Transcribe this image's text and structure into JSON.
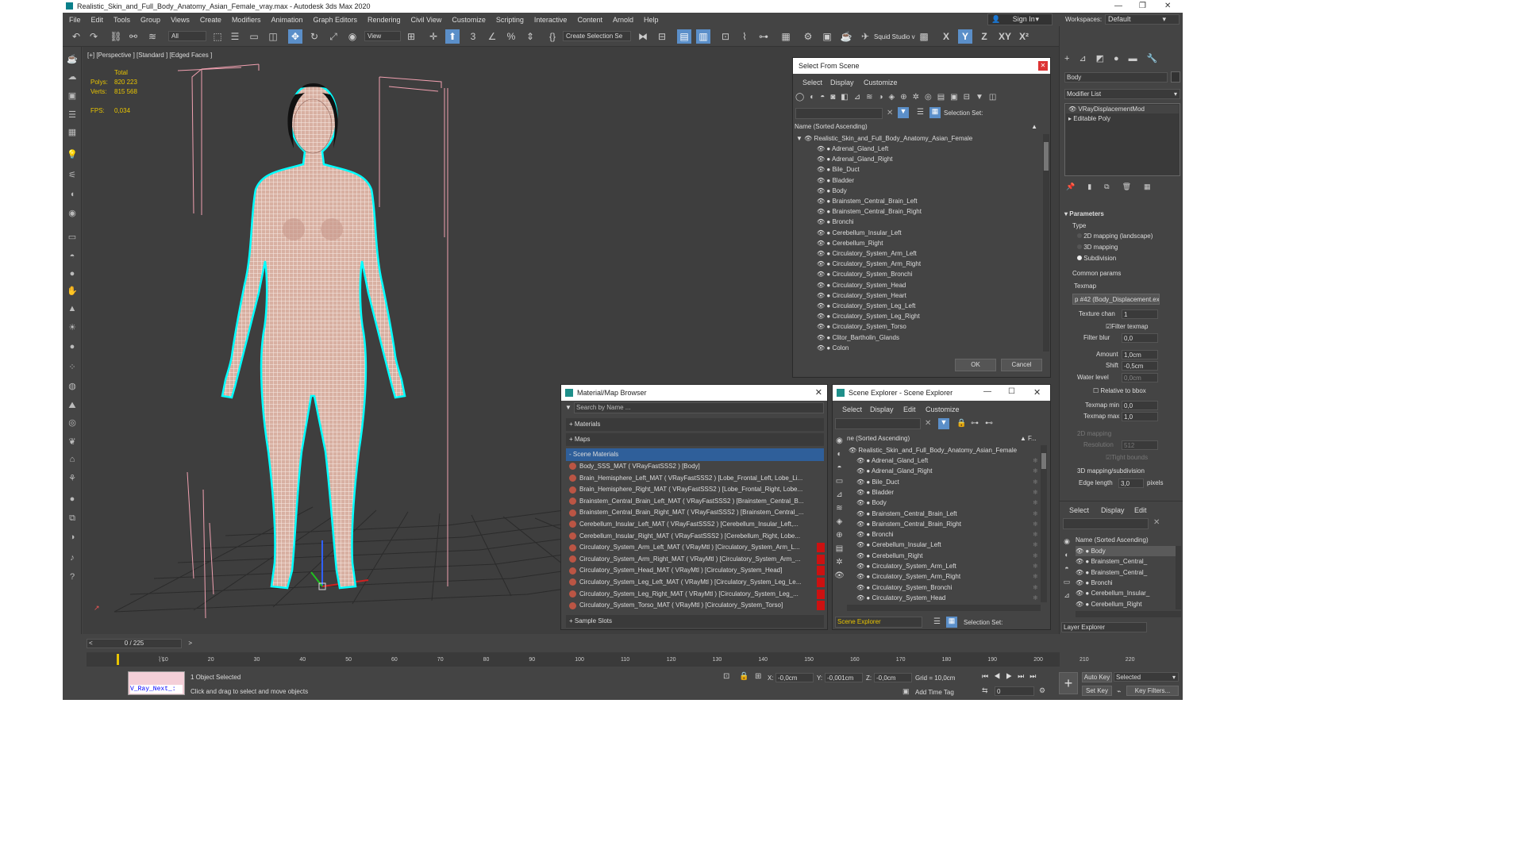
{
  "app": {
    "title": "Realistic_Skin_and_Full_Body_Anatomy_Asian_Female_vray.max - Autodesk 3ds Max 2020"
  },
  "menu": [
    "File",
    "Edit",
    "Tools",
    "Group",
    "Views",
    "Create",
    "Modifiers",
    "Animation",
    "Graph Editors",
    "Rendering",
    "Civil View",
    "Customize",
    "Scripting",
    "Interactive",
    "Content",
    "Arnold",
    "Help"
  ],
  "account": {
    "sign_in": "Sign In",
    "workspaces_label": "Workspaces:",
    "workspace": "Default"
  },
  "toolbar": {
    "filter": "All",
    "view": "View",
    "selection_set": "Create Selection Se",
    "squid": "Squid Studio v",
    "axes": [
      "X",
      "Y",
      "Z",
      "XY"
    ]
  },
  "viewport": {
    "label": "[+] [Perspective ] [Standard ] [Edged Faces ]",
    "stats": {
      "total": "Total",
      "polys_label": "Polys:",
      "polys": "820 223",
      "verts_label": "Verts:",
      "verts": "815 568",
      "fps_label": "FPS:",
      "fps": "0,034"
    }
  },
  "select_from_scene": {
    "title": "Select From Scene",
    "menus": [
      "Select",
      "Display",
      "Customize"
    ],
    "selection_set": "Selection Set:",
    "column": "Name (Sorted Ascending)",
    "root": "Realistic_Skin_and_Full_Body_Anatomy_Asian_Female",
    "items": [
      "Adrenal_Gland_Left",
      "Adrenal_Gland_Right",
      "Bile_Duct",
      "Bladder",
      "Body",
      "Brainstem_Central_Brain_Left",
      "Brainstem_Central_Brain_Right",
      "Bronchi",
      "Cerebellum_Insular_Left",
      "Cerebellum_Right",
      "Circulatory_System_Arm_Left",
      "Circulatory_System_Arm_Right",
      "Circulatory_System_Bronchi",
      "Circulatory_System_Head",
      "Circulatory_System_Heart",
      "Circulatory_System_Leg_Left",
      "Circulatory_System_Leg_Right",
      "Circulatory_System_Torso",
      "Clitor_Bartholin_Glands",
      "Colon"
    ],
    "ok": "OK",
    "cancel": "Cancel"
  },
  "material_browser": {
    "title": "Material/Map Browser",
    "search": "Search by Name ...",
    "sections": [
      "+ Materials",
      "+ Maps",
      "- Scene Materials",
      "+ Sample Slots"
    ],
    "materials": [
      "Body_SSS_MAT ( VRayFastSSS2 ) [Body]",
      "Brain_Hemisphere_Left_MAT ( VRayFastSSS2 ) [Lobe_Frontal_Left, Lobe_Li...",
      "Brain_Hemisphere_Right_MAT ( VRayFastSSS2 ) [Lobe_Frontal_Right, Lobe...",
      "Brainstem_Central_Brain_Left_MAT ( VRayFastSSS2 ) [Brainstem_Central_B...",
      "Brainstem_Central_Brain_Right_MAT ( VRayFastSSS2 ) [Brainstem_Central_...",
      "Cerebellum_Insular_Left_MAT ( VRayFastSSS2 ) [Cerebellum_Insular_Left,...",
      "Cerebellum_Insular_Right_MAT ( VRayFastSSS2 ) [Cerebellum_Right, Lobe...",
      "Circulatory_System_Arm_Left_MAT ( VRayMtl ) [Circulatory_System_Arm_L...",
      "Circulatory_System_Arm_Right_MAT ( VRayMtl ) [Circulatory_System_Arm_...",
      "Circulatory_System_Head_MAT ( VRayMtl ) [Circulatory_System_Head]",
      "Circulatory_System_Leg_Left_MAT ( VRayMtl ) [Circulatory_System_Leg_Le...",
      "Circulatory_System_Leg_Right_MAT ( VRayMtl ) [Circulatory_System_Leg_...",
      "Circulatory_System_Torso_MAT ( VRayMtl ) [Circulatory_System_Torso]"
    ]
  },
  "scene_explorer": {
    "title": "Scene Explorer - Scene Explorer",
    "menus": [
      "Select",
      "Display",
      "Edit",
      "Customize"
    ],
    "column": "ne (Sorted Ascending)",
    "col2": "F...",
    "root": "Realistic_Skin_and_Full_Body_Anatomy_Asian_Female",
    "items": [
      "Adrenal_Gland_Left",
      "Adrenal_Gland_Right",
      "Bile_Duct",
      "Bladder",
      "Body",
      "Brainstem_Central_Brain_Left",
      "Brainstem_Central_Brain_Right",
      "Bronchi",
      "Cerebellum_Insular_Left",
      "Cerebellum_Right",
      "Circulatory_System_Arm_Left",
      "Circulatory_System_Arm_Right",
      "Circulatory_System_Bronchi",
      "Circulatory_System_Head"
    ],
    "footer_name": "Scene Explorer",
    "footer_set": "Selection Set:"
  },
  "command_panel": {
    "object_name": "Body",
    "modifier_list": "Modifier List",
    "stack": [
      "VRayDisplacementMod",
      "Editable Poly"
    ],
    "rollout": "Parameters",
    "type_label": "Type",
    "types": [
      "2D mapping (landscape)",
      "3D mapping",
      "Subdivision"
    ],
    "common": "Common params",
    "texmap_label": "Texmap",
    "texmap": "p #42 (Body_Displacement.ex",
    "tex_chan_label": "Texture chan",
    "tex_chan": "1",
    "filter_texmap": "Filter texmap",
    "filter_blur_label": "Filter blur",
    "filter_blur": "0,0",
    "amount_label": "Amount",
    "amount": "1,0cm",
    "shift_label": "Shift",
    "shift": "-0,5cm",
    "water_label": "Water level",
    "water": "0,0cm",
    "relative": "Relative to bbox",
    "tmin_label": "Texmap min",
    "tmin": "0,0",
    "tmax_label": "Texmap max",
    "tmax": "1,0",
    "map2d": "2D mapping",
    "res_label": "Resolution",
    "res": "512",
    "tight": "Tight bounds",
    "map3d": "3D mapping/subdivision",
    "edge_label": "Edge length",
    "edge": "3,0",
    "edge_unit": "pixels",
    "tabs": [
      "Select",
      "Display",
      "Edit"
    ],
    "list_col": "Name (Sorted Ascending)",
    "list": [
      "Body",
      "Brainstem_Central_",
      "Brainstem_Central_",
      "Bronchi",
      "Cerebellum_Insular_",
      "Cerebellum_Right"
    ],
    "layer": "Layer Explorer"
  },
  "timeline": {
    "frame": "0 / 225",
    "ticks": [
      "10",
      "20",
      "30",
      "40",
      "50",
      "60",
      "70",
      "80",
      "90",
      "100",
      "110",
      "120",
      "130",
      "140",
      "150",
      "160",
      "170",
      "180",
      "190",
      "200",
      "210",
      "220"
    ]
  },
  "status": {
    "script": "V_Ray_Next_:",
    "selected": "1 Object Selected",
    "hint": "Click and drag to select and move objects",
    "x_label": "X:",
    "x": "-0,0cm",
    "y_label": "Y:",
    "y": "-0,001cm",
    "z_label": "Z:",
    "z": "-0,0cm",
    "grid": "Grid = 10,0cm",
    "add_tag": "Add Time Tag",
    "auto_key": "Auto Key",
    "set_key": "Set Key",
    "selected_dd": "Selected",
    "key_filters": "Key Filters...",
    "frame_field": "0"
  },
  "colors": {
    "accent": "#5b8fc9",
    "wire": "#f0c8b8",
    "selection": "#00ffff",
    "red_swatch": "#cc1111"
  }
}
